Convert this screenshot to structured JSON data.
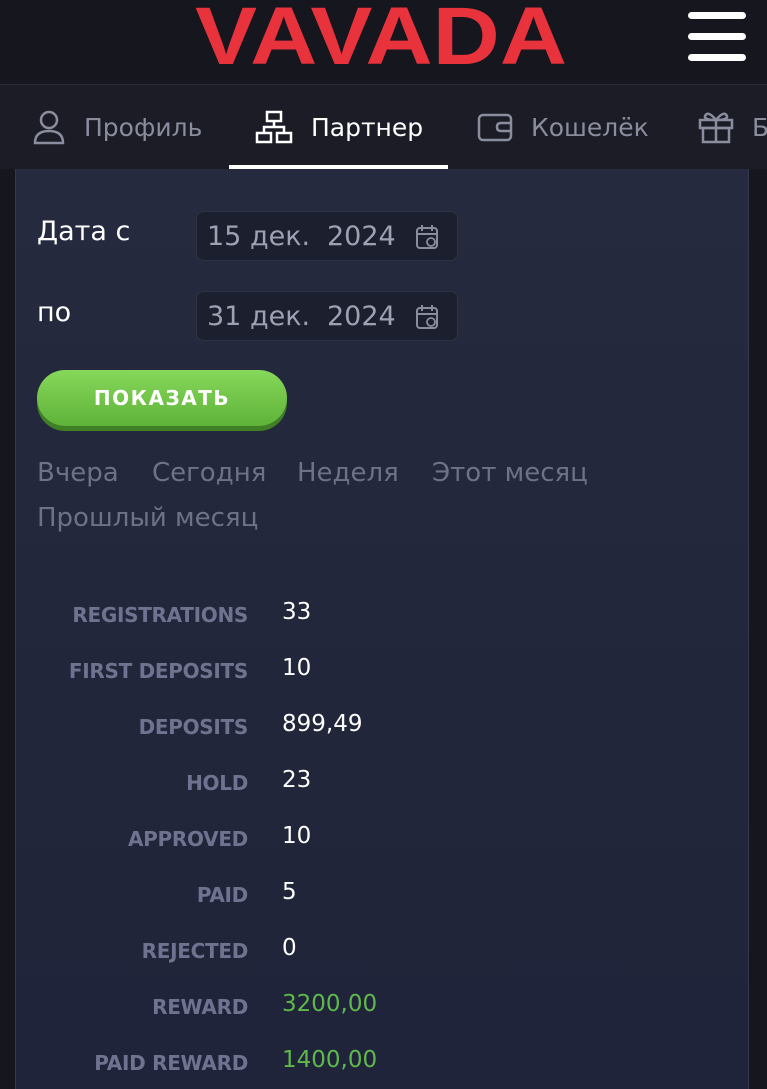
{
  "header": {
    "logo_text": "VAVADA",
    "menu_icon": "hamburger-menu-icon",
    "logo_color": "#e8323c"
  },
  "tabs": [
    {
      "label": "Профиль",
      "icon": "user-icon",
      "active": false
    },
    {
      "label": "Партнер",
      "icon": "network-icon",
      "active": true
    },
    {
      "label": "Кошелёк",
      "icon": "wallet-icon",
      "active": false
    },
    {
      "label": "Б",
      "icon": "gift-icon",
      "active": false
    }
  ],
  "filter": {
    "date_from_label": "Дата с",
    "date_from_day": "15 дек.",
    "date_from_year": "2024",
    "date_to_label": "по",
    "date_to_day": "31 дек.",
    "date_to_year": "2024",
    "calendar_icon": "calendar-icon",
    "show_button": "ПОКАЗАТЬ",
    "quick_ranges": [
      "Вчера",
      "Сегодня",
      "Неделя",
      "Этот месяц",
      "Прошлый месяц"
    ]
  },
  "stats": [
    {
      "label": "REGISTRATIONS",
      "value": "33"
    },
    {
      "label": "FIRST DEPOSITS",
      "value": "10"
    },
    {
      "label": "DEPOSITS",
      "value": "899,49"
    },
    {
      "label": "HOLD",
      "value": "23"
    },
    {
      "label": "APPROVED",
      "value": "10"
    },
    {
      "label": "PAID",
      "value": "5"
    },
    {
      "label": "REJECTED",
      "value": "0"
    },
    {
      "label": "REWARD",
      "value": "3200,00",
      "highlight": true
    },
    {
      "label": "PAID REWARD",
      "value": "1400,00",
      "highlight": true
    }
  ],
  "colors": {
    "accent_green": "#5fb84a",
    "button_green": "#6cc145",
    "background": "#15161e",
    "panel": "#252a3e"
  }
}
